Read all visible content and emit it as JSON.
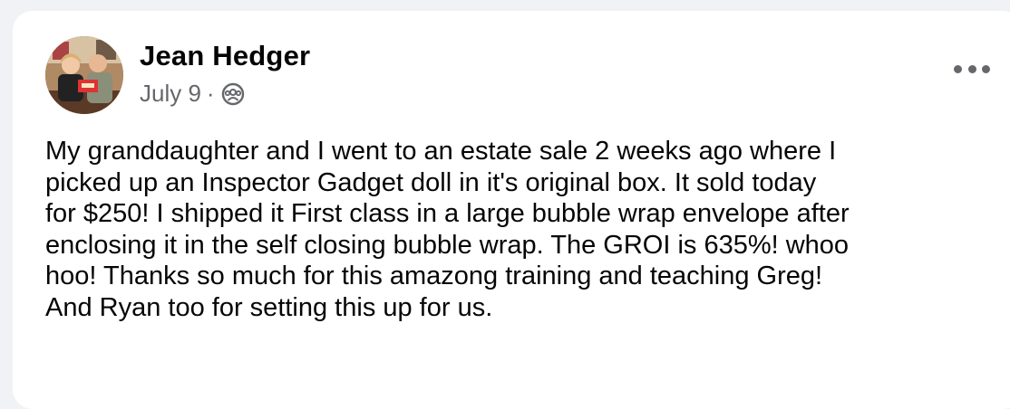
{
  "post": {
    "author": "Jean Hedger",
    "date": "July 9",
    "separator": "·",
    "audience_icon": "group-icon",
    "more_icon": "more-options-icon",
    "text": "My granddaughter and I went to an estate sale 2 weeks ago where I\npicked up an Inspector Gadget doll in it's original box. It sold today\nfor $250! I shipped it First class in a large bubble wrap envelope after\nenclosing it in the self closing bubble wrap. The GROI is 635%! whoo\nhoo! Thanks so much for this amazong training and teaching Greg!\nAnd Ryan too for setting this up for us."
  },
  "colors": {
    "background": "#f0f2f5",
    "card": "#ffffff",
    "primary_text": "#050505",
    "secondary_text": "#65676b"
  }
}
